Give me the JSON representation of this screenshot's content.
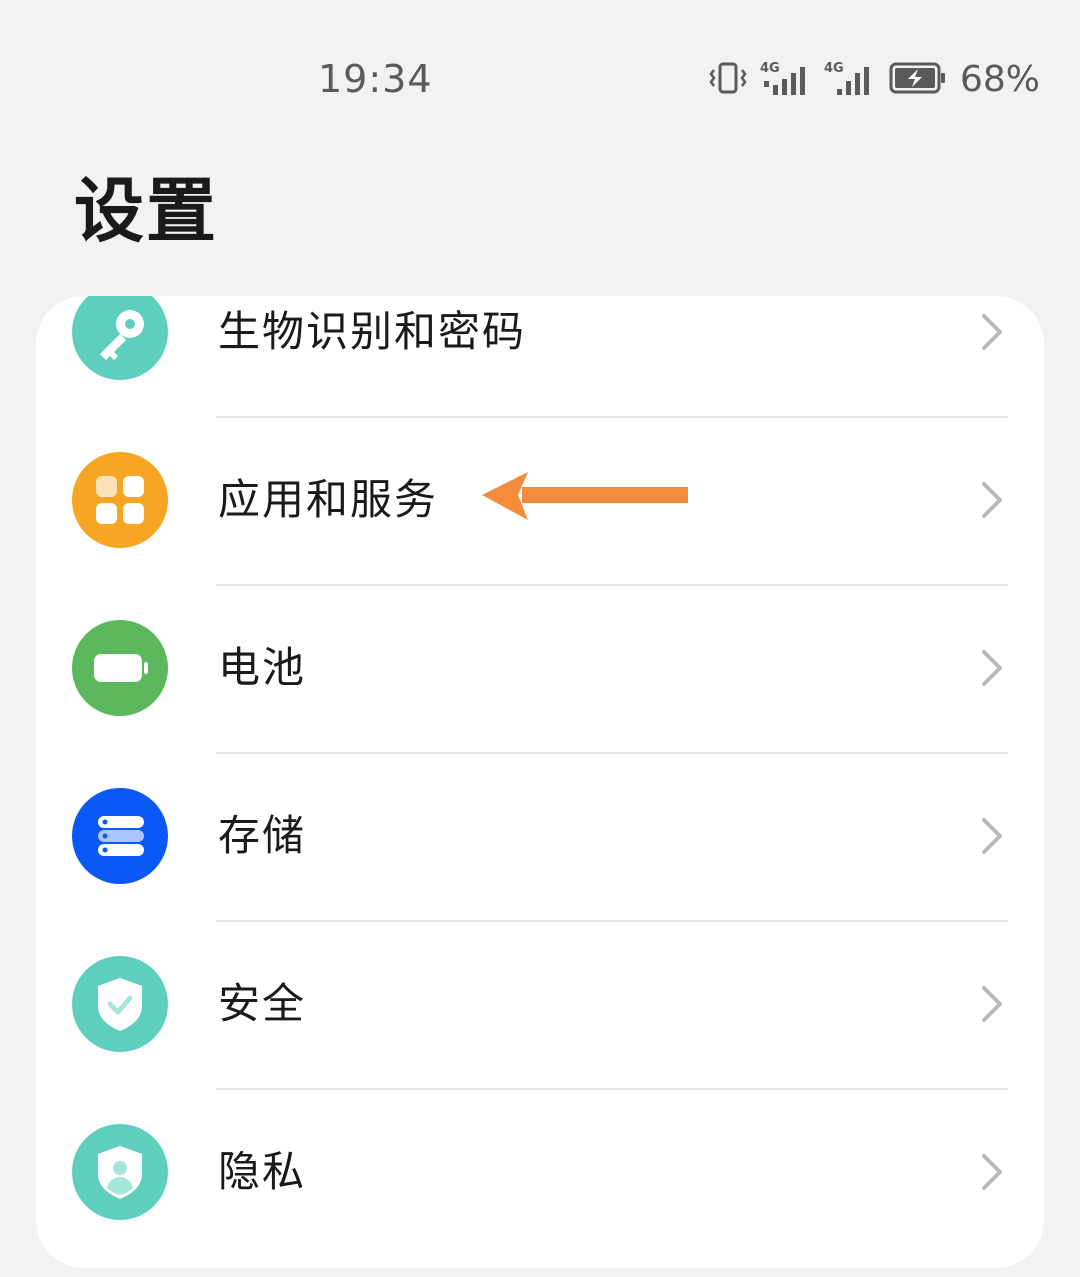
{
  "status_bar": {
    "time": "19:34",
    "battery_percent": "68%",
    "network_1": "4G",
    "network_2": "4G",
    "icons": [
      "vibrate-icon",
      "signal-4g-icon",
      "signal-4g-icon",
      "battery-charging-icon"
    ]
  },
  "page": {
    "title": "设置"
  },
  "settings": {
    "items": [
      {
        "label": "生物识别和密码",
        "icon": "key-icon",
        "color": "#5fcfbd"
      },
      {
        "label": "应用和服务",
        "icon": "apps-grid-icon",
        "color": "#f6a623"
      },
      {
        "label": "电池",
        "icon": "battery-icon",
        "color": "#5cb85c"
      },
      {
        "label": "存储",
        "icon": "storage-icon",
        "color": "#0a59f7"
      },
      {
        "label": "安全",
        "icon": "shield-check-icon",
        "color": "#5fcfbd"
      },
      {
        "label": "隐私",
        "icon": "privacy-shield-icon",
        "color": "#5fcfbd"
      }
    ]
  },
  "annotation": {
    "icon": "orange-arrow-icon",
    "color": "#f78b3c"
  }
}
